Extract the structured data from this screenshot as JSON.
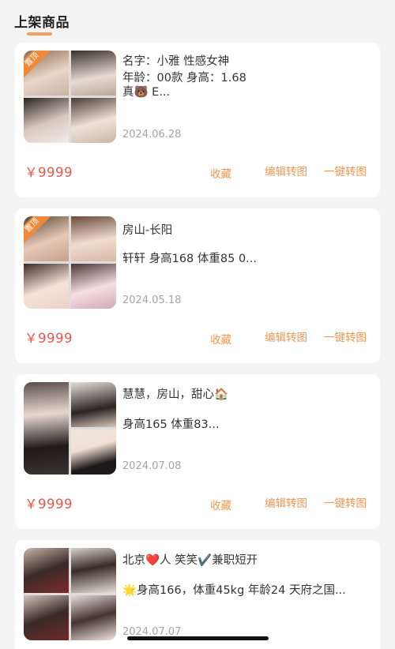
{
  "header": {
    "tab_label": "上架商品",
    "accent_color": "#f0a162"
  },
  "colors": {
    "price": "#e8584c",
    "action": "#ef9650",
    "badge": "#f08a3a",
    "date": "#a5a5a5"
  },
  "products": [
    {
      "badge": "置顶",
      "lines": [
        "名字：小雅  性感女神",
        "年龄：00款          身高：1.68",
        "真🐻 E..."
      ],
      "date": "2024.06.28",
      "price": "￥9999",
      "fav": "收藏",
      "edit": "编辑转图",
      "oneclick": "一键转图"
    },
    {
      "badge": "置顶",
      "lines": [
        "房山-长阳",
        "轩轩  身高168  体重85   0..."
      ],
      "date": "2024.05.18",
      "price": "￥9999",
      "fav": "收藏",
      "edit": "编辑转图",
      "oneclick": "一键转图"
    },
    {
      "lines": [
        "慧慧，房山，甜心🏠",
        " 身高165    体重83..."
      ],
      "date": "2024.07.08",
      "price": "￥9999",
      "fav": "收藏",
      "edit": "编辑转图",
      "oneclick": "一键转图"
    },
    {
      "lines": [
        "北京❤️人 笑笑✔️兼职短开",
        "🌟身高166，体重45kg   年龄24 天府之国..."
      ],
      "date": "2024.07.07"
    }
  ]
}
